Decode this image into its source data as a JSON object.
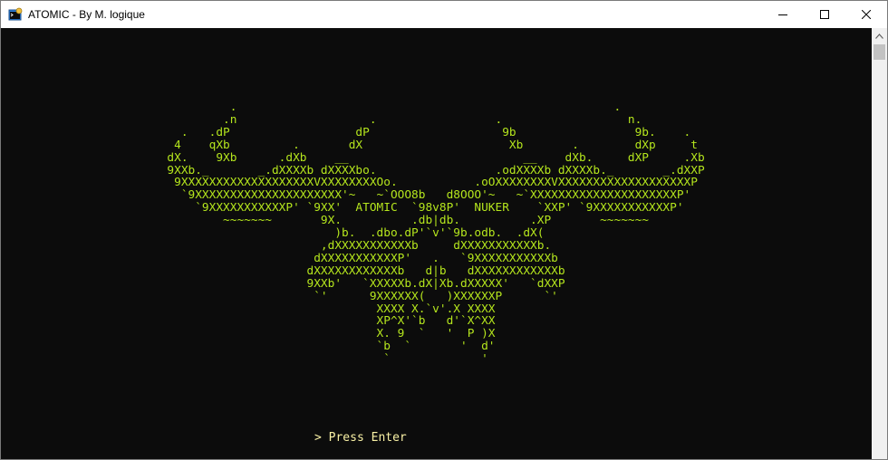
{
  "window": {
    "title": "ATOMIC - By M. logique"
  },
  "controls": {
    "minimize_icon": "minimize-icon",
    "maximize_icon": "maximize-icon",
    "close_icon": "close-icon"
  },
  "console": {
    "text_color": "#b5e61d",
    "prompt_color": "#f9f1a5",
    "background": "#0c0c0c",
    "ascii_art": "           .                                                      .\n          .n                   .                 .                  n.\n    .   .dP                  dP                   9b                 9b.    .\n   4    qXb         .       dX                     Xb       .        dXp     t\n  dX.    9Xb      .dXb    __                         __    dXb.     dXP     .Xb\n  9XXb._       _.dXXXXb dXXXXbo.                 .odXXXXb dXXXXb._       _.dXXP\n   9XXXXXXXXXXXXXXXXXXXVXXXXXXXXOo.           .oOXXXXXXXXVXXXXXXXXXXXXXXXXXXXP\n    `9XXXXXXXXXXXXXXXXXXXXX'~   ~`OOO8b   d8OOO'~   ~`XXXXXXXXXXXXXXXXXXXXXP'\n      `9XXXXXXXXXXXP' `9XX'  ATOMIC  `98v8P'  NUKER    `XXP' `9XXXXXXXXXXXP'\n          ~~~~~~~       9X.          .db|db.          .XP       ~~~~~~~\n                          )b.  .dbo.dP'`v'`9b.odb.  .dX(\n                        ,dXXXXXXXXXXXb     dXXXXXXXXXXXb.\n                       dXXXXXXXXXXXP'   .   `9XXXXXXXXXXXb\n                      dXXXXXXXXXXXXb   d|b   dXXXXXXXXXXXXb\n                      9XXb'   `XXXXXb.dX|Xb.dXXXXX'   `dXXP\n                       `'      9XXXXXX(   )XXXXXXP      `'\n                                XXXX X.`v'.X XXXX\n                                XP^X'`b   d'`X^XX\n                                X. 9  `   '  P )X\n                                `b  `       '  d'\n                                 `             '",
    "prompt": "> Press Enter"
  },
  "scrollbar": {
    "up_icon": "scroll-up-arrow-icon"
  }
}
